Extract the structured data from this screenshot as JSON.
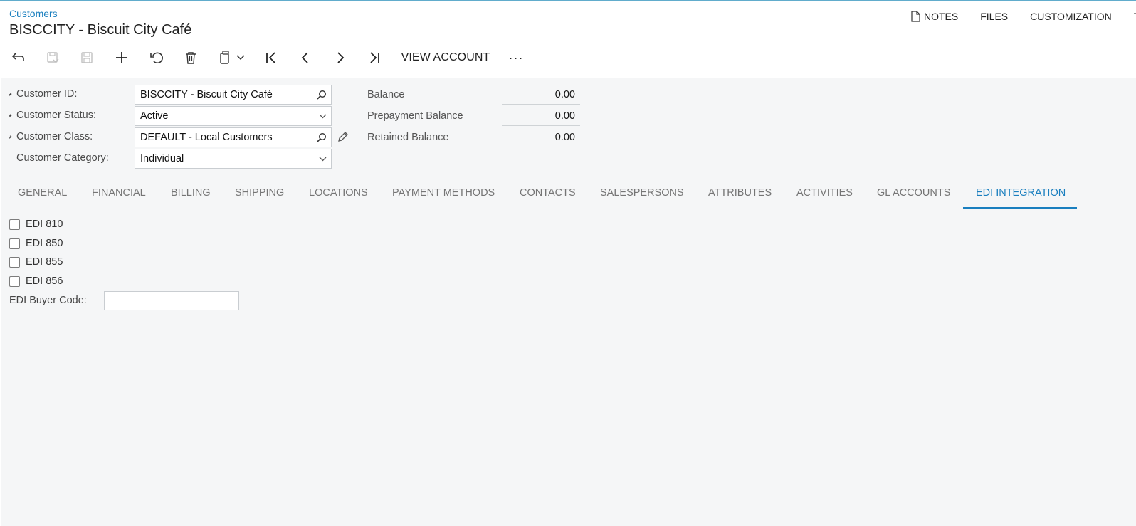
{
  "header": {
    "breadcrumb": "Customers",
    "title": "BISCCITY - Biscuit City Café",
    "actions": {
      "notes": "NOTES",
      "files": "FILES",
      "customization": "CUSTOMIZATION",
      "tools": "T"
    }
  },
  "toolbar": {
    "view_account": "VIEW ACCOUNT",
    "more": "···",
    "icons": [
      "undo-arrow-icon",
      "save-close-icon",
      "save-icon",
      "add-icon",
      "cancel-icon",
      "delete-icon",
      "clipboard-icon",
      "first-record-icon",
      "prev-record-icon",
      "next-record-icon",
      "last-record-icon",
      "more-icon"
    ]
  },
  "form": {
    "customer_id": {
      "label": "Customer ID:",
      "value": "BISCCITY - Biscuit City Café"
    },
    "customer_status": {
      "label": "Customer Status:",
      "value": "Active"
    },
    "customer_class": {
      "label": "Customer Class:",
      "value": "DEFAULT - Local Customers"
    },
    "customer_category": {
      "label": "Customer Category:",
      "value": "Individual"
    },
    "required_marker": "*",
    "balance": {
      "label": "Balance",
      "value": "0.00"
    },
    "prepayment_balance": {
      "label": "Prepayment Balance",
      "value": "0.00"
    },
    "retained_balance": {
      "label": "Retained Balance",
      "value": "0.00"
    }
  },
  "tabs": [
    {
      "label": "GENERAL"
    },
    {
      "label": "FINANCIAL"
    },
    {
      "label": "BILLING"
    },
    {
      "label": "SHIPPING"
    },
    {
      "label": "LOCATIONS"
    },
    {
      "label": "PAYMENT METHODS"
    },
    {
      "label": "CONTACTS"
    },
    {
      "label": "SALESPERSONS"
    },
    {
      "label": "ATTRIBUTES"
    },
    {
      "label": "ACTIVITIES"
    },
    {
      "label": "GL ACCOUNTS"
    },
    {
      "label": "EDI INTEGRATION",
      "active": true
    }
  ],
  "edi": {
    "checkboxes": [
      {
        "label": "EDI 810",
        "checked": false
      },
      {
        "label": "EDI 850",
        "checked": false
      },
      {
        "label": "EDI 855",
        "checked": false
      },
      {
        "label": "EDI 856",
        "checked": false
      }
    ],
    "buyer_code": {
      "label": "EDI Buyer Code:",
      "value": ""
    }
  },
  "colors": {
    "accent": "#1a7fbf",
    "panel_bg": "#f5f6f7",
    "border": "#c9cdd1"
  }
}
